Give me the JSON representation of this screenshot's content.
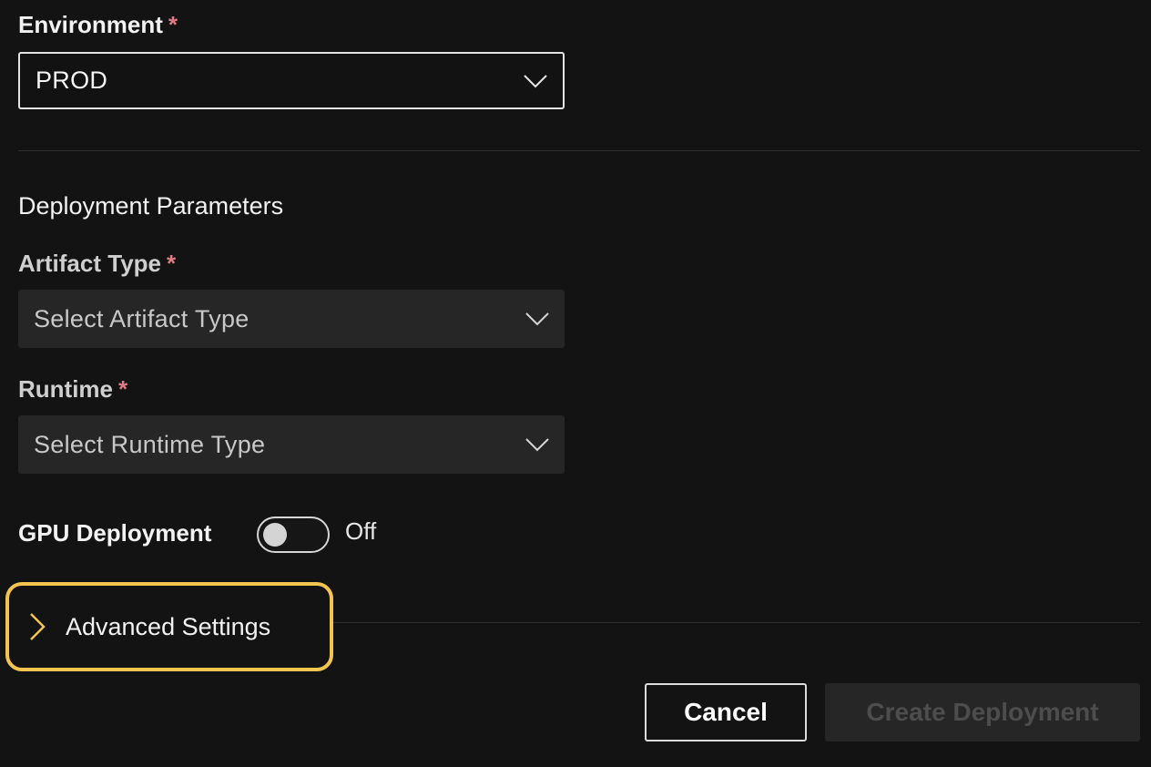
{
  "environment": {
    "label": "Environment",
    "required_mark": "*",
    "value": "PROD",
    "icon": "chevron-down-icon"
  },
  "section": {
    "title": "Deployment Parameters"
  },
  "artifact_type": {
    "label": "Artifact Type",
    "required_mark": "*",
    "placeholder": "Select Artifact Type",
    "icon": "chevron-down-icon"
  },
  "runtime": {
    "label": "Runtime",
    "required_mark": "*",
    "placeholder": "Select Runtime Type",
    "icon": "chevron-down-icon"
  },
  "gpu_deployment": {
    "label": "GPU Deployment",
    "enabled": false,
    "state_text": "Off"
  },
  "advanced_settings": {
    "label": "Advanced Settings",
    "expanded": false,
    "icon": "chevron-right-icon"
  },
  "actions": {
    "cancel_label": "Cancel",
    "create_label": "Create Deployment",
    "create_enabled": false
  },
  "colors": {
    "background": "#131313",
    "required": "#e07a86",
    "focus_ring": "#f2c450",
    "filled_input": "#262626",
    "disabled_text": "#4d4d4d"
  }
}
